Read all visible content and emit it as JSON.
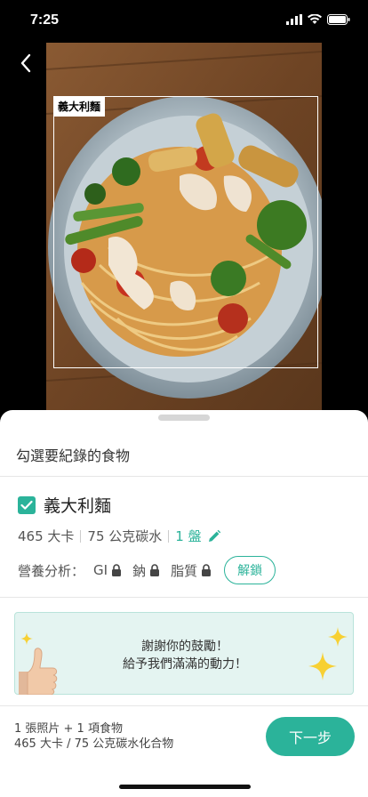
{
  "status": {
    "time": "7:25"
  },
  "photo": {
    "detected_label": "義大利麵"
  },
  "sheet": {
    "title": "勾選要紀錄的食物",
    "food": {
      "name": "義大利麵",
      "checked": true,
      "calories": "465 大卡",
      "carbs": "75 公克碳水",
      "portion": "1 盤"
    },
    "nutrition": {
      "label": "營養分析：",
      "items": [
        "GI",
        "鈉",
        "脂質"
      ],
      "unlock_label": "解鎖"
    },
    "banner": {
      "line1": "謝謝你的鼓勵！",
      "line2": "給予我們滿滿的動力！"
    },
    "footer": {
      "summary": "1 張照片 + 1 項食物",
      "totals": "465 大卡 / 75 公克碳水化合物",
      "next_label": "下一步"
    }
  },
  "colors": {
    "accent": "#2bb39a",
    "banner_bg": "#e4f4f1",
    "sparkle": "#f7d033"
  },
  "icons": [
    "back-icon",
    "signal-icon",
    "wifi-icon",
    "battery-icon",
    "checkbox-checked-icon",
    "pencil-icon",
    "lock-icon",
    "thumbs-up-icon",
    "sparkle-icon"
  ]
}
